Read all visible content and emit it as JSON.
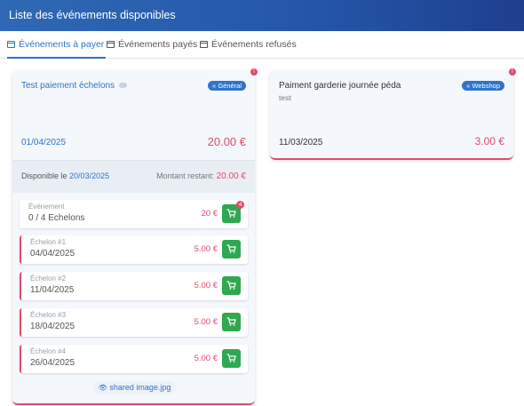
{
  "header": {
    "title": "Liste des événements disponibles"
  },
  "tabs": [
    {
      "label": "Événements à payer",
      "active": true
    },
    {
      "label": "Événements payés",
      "active": false
    },
    {
      "label": "Événements refusés",
      "active": false
    }
  ],
  "card1": {
    "title": "Test paiement échelons",
    "badge": "Général",
    "date": "01/04/2025",
    "price": "20.00 €",
    "dispo_label": "Disponible le",
    "dispo_date": "20/03/2025",
    "remaining_label": "Montant restant:",
    "remaining_value": "20.00 €",
    "dot": "!",
    "event_row": {
      "label": "Événement",
      "value": "0 / 4 Echelons",
      "price": "20 €",
      "cart_count": "4"
    },
    "steps": [
      {
        "label": "Échelon #1",
        "date": "04/04/2025",
        "price": "5.00 €"
      },
      {
        "label": "Échelon #2",
        "date": "11/04/2025",
        "price": "5.00 €"
      },
      {
        "label": "Échelon #3",
        "date": "18/04/2025",
        "price": "5.00 €"
      },
      {
        "label": "Échelon #4",
        "date": "26/04/2025",
        "price": "5.00 €"
      }
    ],
    "attachment": "shared image.jpg"
  },
  "card2": {
    "title": "Paiment garderie journée péda",
    "subtitle": "test",
    "badge": "Webshop",
    "date": "11/03/2025",
    "price": "3.00 €",
    "dot": "!"
  },
  "colors": {
    "primary": "#2f74c8",
    "danger": "#e24b6d",
    "success": "#2fa84f",
    "header": "#2456a8"
  }
}
